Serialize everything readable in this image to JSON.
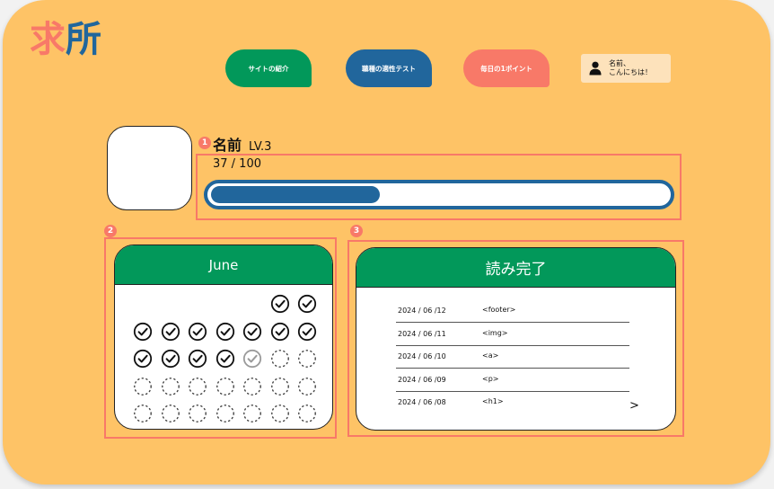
{
  "logo": {
    "chars": [
      {
        "text": "求",
        "color": "#f87968"
      },
      {
        "text": "所",
        "color": "#21669c"
      }
    ],
    "accent_green": "#02985a"
  },
  "nav": {
    "items": [
      {
        "label": "サイトの紹介",
        "color": "#02985a"
      },
      {
        "label": "職種の適性テスト",
        "color": "#21669c"
      },
      {
        "label": "毎日の1ポイント",
        "color": "#f87968"
      }
    ]
  },
  "user": {
    "icon": "person-icon",
    "line1": "名前、",
    "line2": "こんにちは！"
  },
  "profile": {
    "badge": "1",
    "name": "名前",
    "level": "LV.3",
    "xp_text": "37 / 100",
    "xp_fraction": 0.37
  },
  "calendar": {
    "badge": "2",
    "month": "June",
    "leading_blanks": 5,
    "days": [
      "done",
      "done",
      "done",
      "done",
      "done",
      "done",
      "done",
      "done",
      "done",
      "done",
      "done",
      "done",
      "done",
      "today",
      "empty",
      "empty",
      "empty",
      "empty",
      "empty",
      "empty",
      "empty",
      "empty",
      "empty",
      "empty",
      "empty",
      "empty",
      "empty",
      "empty",
      "empty",
      "empty"
    ]
  },
  "reading": {
    "badge": "3",
    "title": "読み完了",
    "rows": [
      {
        "date": "2024 / 06 /12",
        "tag": "<footer>"
      },
      {
        "date": "2024 / 06 /11",
        "tag": "<img>"
      },
      {
        "date": "2024 / 06 /10",
        "tag": "<a>"
      },
      {
        "date": "2024 / 06 /09",
        "tag": "<p>"
      },
      {
        "date": "2024 / 06 /08",
        "tag": "<h1>"
      }
    ],
    "more": ">"
  },
  "colors": {
    "background": "#fec366",
    "primary_blue": "#21669c",
    "coral": "#f87968",
    "green": "#02985a"
  }
}
